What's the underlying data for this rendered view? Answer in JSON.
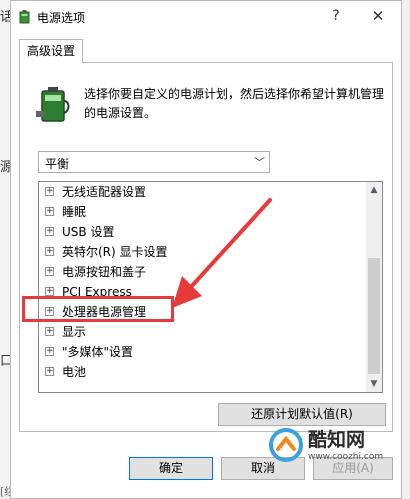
{
  "background": {
    "fragment_1": "话",
    "fragment_2": "源",
    "fragment_3": "口",
    "bottom_fragment": "[续]"
  },
  "dialog": {
    "title": "电源选项",
    "help_glyph": "?",
    "close_glyph": "✕",
    "tab_label": "高级设置",
    "description": "选择你要自定义的电源计划，然后选择你希望计算机管理的电源设置。",
    "plan_dropdown": {
      "value": "平衡"
    },
    "tree_items": [
      {
        "label": "无线适配器设置"
      },
      {
        "label": "睡眠"
      },
      {
        "label": "USB 设置"
      },
      {
        "label": "英特尔(R) 显卡设置"
      },
      {
        "label": "电源按钮和盖子"
      },
      {
        "label": "PCI Express"
      },
      {
        "label": "处理器电源管理"
      },
      {
        "label": "显示"
      },
      {
        "label": "\"多媒体\"设置"
      },
      {
        "label": "电池"
      }
    ],
    "restore_button": "还原计划默认值(R)",
    "ok_button": "确定",
    "cancel_button": "取消",
    "apply_button": "应用(A)"
  },
  "watermark": {
    "name": "酷知网",
    "url": "www.coozhi.com"
  },
  "colors": {
    "annotation_red": "#e83a3a",
    "accent_blue": "#0078d7"
  }
}
